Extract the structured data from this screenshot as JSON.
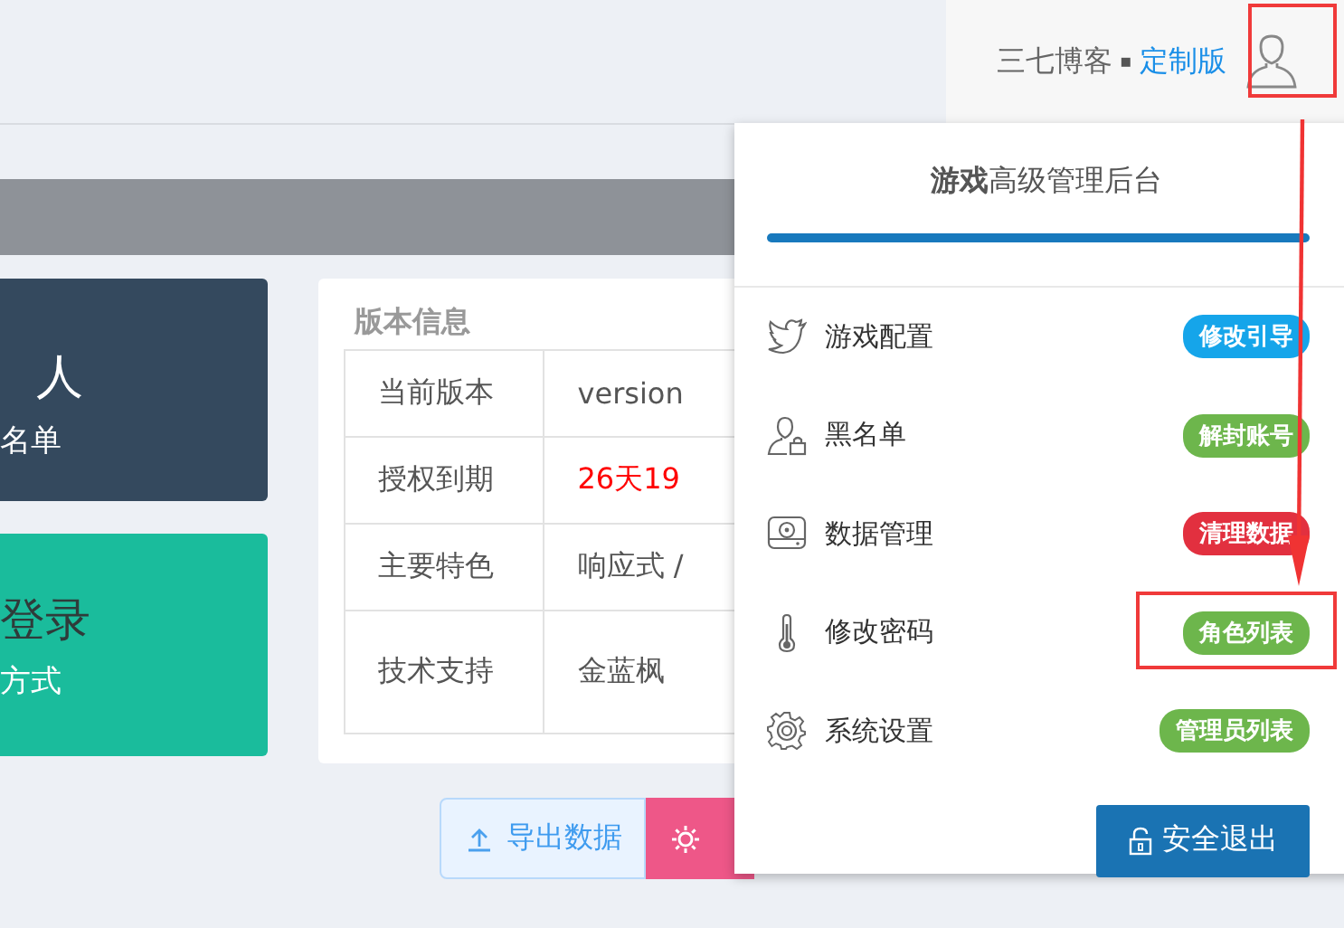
{
  "header": {
    "site_name": "三七博客",
    "separator": "▪",
    "edition": "定制版"
  },
  "cards": [
    {
      "kind": "count",
      "unit": "人",
      "sub": "名单"
    },
    {
      "kind": "login",
      "big": "登录",
      "sub": "方式"
    }
  ],
  "version_info": {
    "title": "版本信息",
    "rows": [
      {
        "label": "当前版本",
        "value": "version",
        "highlight": false
      },
      {
        "label": "授权到期",
        "value": "26天19",
        "highlight": true
      },
      {
        "label": "主要特色",
        "value": "响应式 /",
        "highlight": false
      },
      {
        "label": "技术支持",
        "value": "金蓝枫",
        "highlight": false
      }
    ]
  },
  "actions": [
    {
      "kind": "export",
      "label": "导出数据"
    },
    {
      "kind": "tool"
    }
  ],
  "menu": {
    "title": "**游戏**高级管理后台",
    "items": [
      {
        "kind": "bird",
        "label": "游戏配置",
        "badge": "修改引导",
        "color": "#15a5ea"
      },
      {
        "kind": "user-lock",
        "label": "黑名单",
        "badge": "解封账号",
        "color": "#6db64c"
      },
      {
        "kind": "disk",
        "label": "数据管理",
        "badge": "清理数据",
        "color": "#e2303f"
      },
      {
        "kind": "thermometer",
        "label": "修改密码",
        "badge": "角色列表",
        "color": "#6db64c"
      },
      {
        "kind": "gear",
        "label": "系统设置",
        "badge": "管理员列表",
        "color": "#6db64c"
      }
    ],
    "logout": "安全退出"
  }
}
